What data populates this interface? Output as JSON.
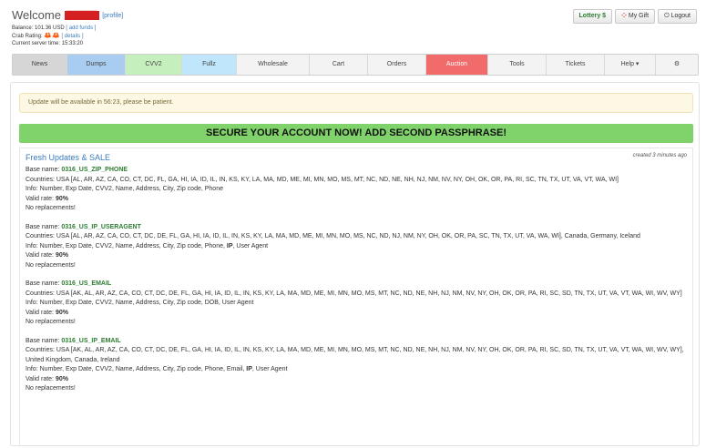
{
  "header": {
    "welcome_label": "Welcome",
    "username_redacted": "██████",
    "profile_link": "[profile]",
    "balance_label": "Balance:",
    "balance_value": "101.36 USD",
    "add_funds_link": "[ add funds ]",
    "crab_label": "Crab Rating:",
    "crab_icons": "🦀🦀",
    "details_link": "[ details ]",
    "server_time_label": "Current server time:",
    "server_time_value": "15:33:20"
  },
  "top_buttons": {
    "lottery": "Lottery $",
    "gift": "My Gift",
    "logout": "Logout"
  },
  "nav": [
    {
      "label": "News",
      "bg": "#d6d6d6"
    },
    {
      "label": "Dumps",
      "bg": "#a9cdf0"
    },
    {
      "label": "CVV2",
      "bg": "#c5efbd"
    },
    {
      "label": "Fullz",
      "bg": "#bfe6fb"
    },
    {
      "label": "Wholesale",
      "bg": "#f3f3f3"
    },
    {
      "label": "Cart",
      "bg": "#f3f3f3"
    },
    {
      "label": "Orders",
      "bg": "#f3f3f3"
    },
    {
      "label": "Auction",
      "bg": "#f26b6b"
    },
    {
      "label": "Tools",
      "bg": "#f3f3f3"
    },
    {
      "label": "Tickets",
      "bg": "#f3f3f3"
    },
    {
      "label": "Help ▾",
      "bg": "#f3f3f3"
    },
    {
      "label": "⚙",
      "bg": "#f3f3f3"
    }
  ],
  "notice": "Update will be available in 56:23, please be patient.",
  "secure_banner": "SECURE YOUR ACCOUNT NOW! ADD SECOND PASSPHRASE!",
  "updates": {
    "title": "Fresh Updates & SALE",
    "created": "created 3 minutes ago",
    "entries": [
      {
        "base_label": "Base name:",
        "base_name": "0316_US_ZIP_PHONE",
        "countries_label": "Countries:",
        "countries": "USA [AL, AR, AZ, CA, CO, CT, DC, FL, GA, HI, IA, ID, IL, IN, KS, KY, LA, MA, MD, ME, MI, MN, MO, MS, MT, NC, ND, NE, NH, NJ, NM, NV, NY, OH, OK, OR, PA, RI, SC, TN, TX, UT, VA, VT, WA, WI]",
        "info_label": "Info:",
        "info": "Number, Exp Date, CVV2, Name, Address, City, Zip code, Phone",
        "info_ip": "",
        "info_tail": "",
        "valid_label": "Valid rate:",
        "valid": "90%",
        "replacements": "No replacements!"
      },
      {
        "base_label": "Base name:",
        "base_name": "0316_US_IP_USERAGENT",
        "countries_label": "Countries:",
        "countries": "USA [AL, AR, AZ, CA, CO, CT, DC, DE, FL, GA, HI, IA, ID, IL, IN, KS, KY, LA, MA, MD, ME, MI, MN, MO, MS, NC, ND, NJ, NM, NY, OH, OK, OR, PA, SC, TN, TX, UT, VA, WA, WI], Canada, Germany, Iceland",
        "info_label": "Info:",
        "info": "Number, Exp Date, CVV2, Name, Address, City, Zip code, Phone,",
        "info_ip": "IP",
        "info_tail": ", User Agent",
        "valid_label": "Valid rate:",
        "valid": "90%",
        "replacements": "No replacements!"
      },
      {
        "base_label": "Base name:",
        "base_name": "0316_US_EMAIL",
        "countries_label": "Countries:",
        "countries": "USA [AK, AL, AR, AZ, CA, CO, CT, DC, DE, FL, GA, HI, IA, ID, IL, IN, KS, KY, LA, MA, MD, ME, MI, MN, MO, MS, MT, NC, ND, NE, NH, NJ, NM, NV, NY, OH, OK, OR, PA, RI, SC, SD, TN, TX, UT, VA, VT, WA, WI, WV, WY]",
        "info_label": "Info:",
        "info": "Number, Exp Date, CVV2, Name, Address, City, Zip code, DOB, User Agent",
        "info_ip": "",
        "info_tail": "",
        "valid_label": "Valid rate:",
        "valid": "90%",
        "replacements": "No replacements!"
      },
      {
        "base_label": "Base name:",
        "base_name": "0316_US_IP_EMAIL",
        "countries_label": "Countries:",
        "countries": "USA [AK, AL, AR, AZ, CA, CO, CT, DC, DE, FL, GA, HI, IA, ID, IL, IN, KS, KY, LA, MA, MD, ME, MI, MN, MO, MS, MT, NC, ND, NE, NH, NJ, NM, NV, NY, OH, OK, OR, PA, RI, SC, SD, TN, TX, UT, VA, VT, WA, WI, WV, WY], United Kingdom, Canada, Ireland",
        "info_label": "Info:",
        "info": "Number, Exp Date, CVV2, Name, Address, City, Zip code, Phone, Email,",
        "info_ip": "IP",
        "info_tail": ", User Agent",
        "valid_label": "Valid rate:",
        "valid": "90%",
        "replacements": "No replacements!"
      }
    ]
  }
}
